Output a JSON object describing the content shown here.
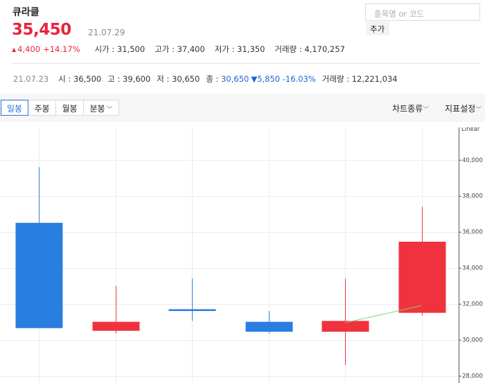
{
  "stock": {
    "name": "큐라클",
    "price": "35,450",
    "date": "21.07.29",
    "change_arrow": "▲",
    "change": "4,400",
    "change_pct": "+14.17%",
    "stats": [
      {
        "label": "시가",
        "value": "31,500"
      },
      {
        "label": "고가",
        "value": "37,400"
      },
      {
        "label": "저가",
        "value": "31,350"
      },
      {
        "label": "거래량",
        "value": "4,170,257"
      }
    ]
  },
  "search": {
    "placeholder": "종목명 or 코드",
    "add_label": "추가"
  },
  "prev": {
    "date": "21.07.23",
    "open_label": "시",
    "open": "36,500",
    "high_label": "고",
    "high": "39,600",
    "low_label": "저",
    "low": "30,650",
    "close_label": "종",
    "close": "30,650",
    "change_arrow": "▼",
    "change": "5,850",
    "change_pct": "-16.03%",
    "volume_label": "거래량",
    "volume": "12,221,034"
  },
  "toolbar": {
    "tabs": [
      {
        "label": "일봉",
        "active": true
      },
      {
        "label": "주봉",
        "active": false
      },
      {
        "label": "월봉",
        "active": false
      },
      {
        "label": "분봉",
        "active": false,
        "dropdown": true
      }
    ],
    "chart_type_label": "차트종류",
    "indicator_label": "지표설정"
  },
  "colors": {
    "up": "#f0323f",
    "down": "#2a7de1",
    "ma": "#7ed17a",
    "grid": "#ececec"
  },
  "chart_data": {
    "type": "candlestick",
    "scale_label": "Linear",
    "ylim": [
      27600,
      41800
    ],
    "y_ticks": [
      28000,
      30000,
      32000,
      34000,
      36000,
      38000,
      40000
    ],
    "y_tick_labels": [
      "28,000",
      "30,000",
      "32,000",
      "34,000",
      "36,000",
      "38,000",
      "40,000"
    ],
    "candles": [
      {
        "open": 36500,
        "high": 39600,
        "low": 30650,
        "close": 30650
      },
      {
        "open": 30500,
        "high": 33000,
        "low": 30350,
        "close": 31000
      },
      {
        "open": 31700,
        "high": 33400,
        "low": 31050,
        "close": 31600
      },
      {
        "open": 31000,
        "high": 31600,
        "low": 30350,
        "close": 30450
      },
      {
        "open": 30450,
        "high": 33400,
        "low": 28600,
        "close": 31050
      },
      {
        "open": 31500,
        "high": 37400,
        "low": 31350,
        "close": 35450
      }
    ],
    "ma": [
      {
        "index": 4,
        "value": 30950
      },
      {
        "index": 5,
        "value": 31900
      }
    ]
  }
}
